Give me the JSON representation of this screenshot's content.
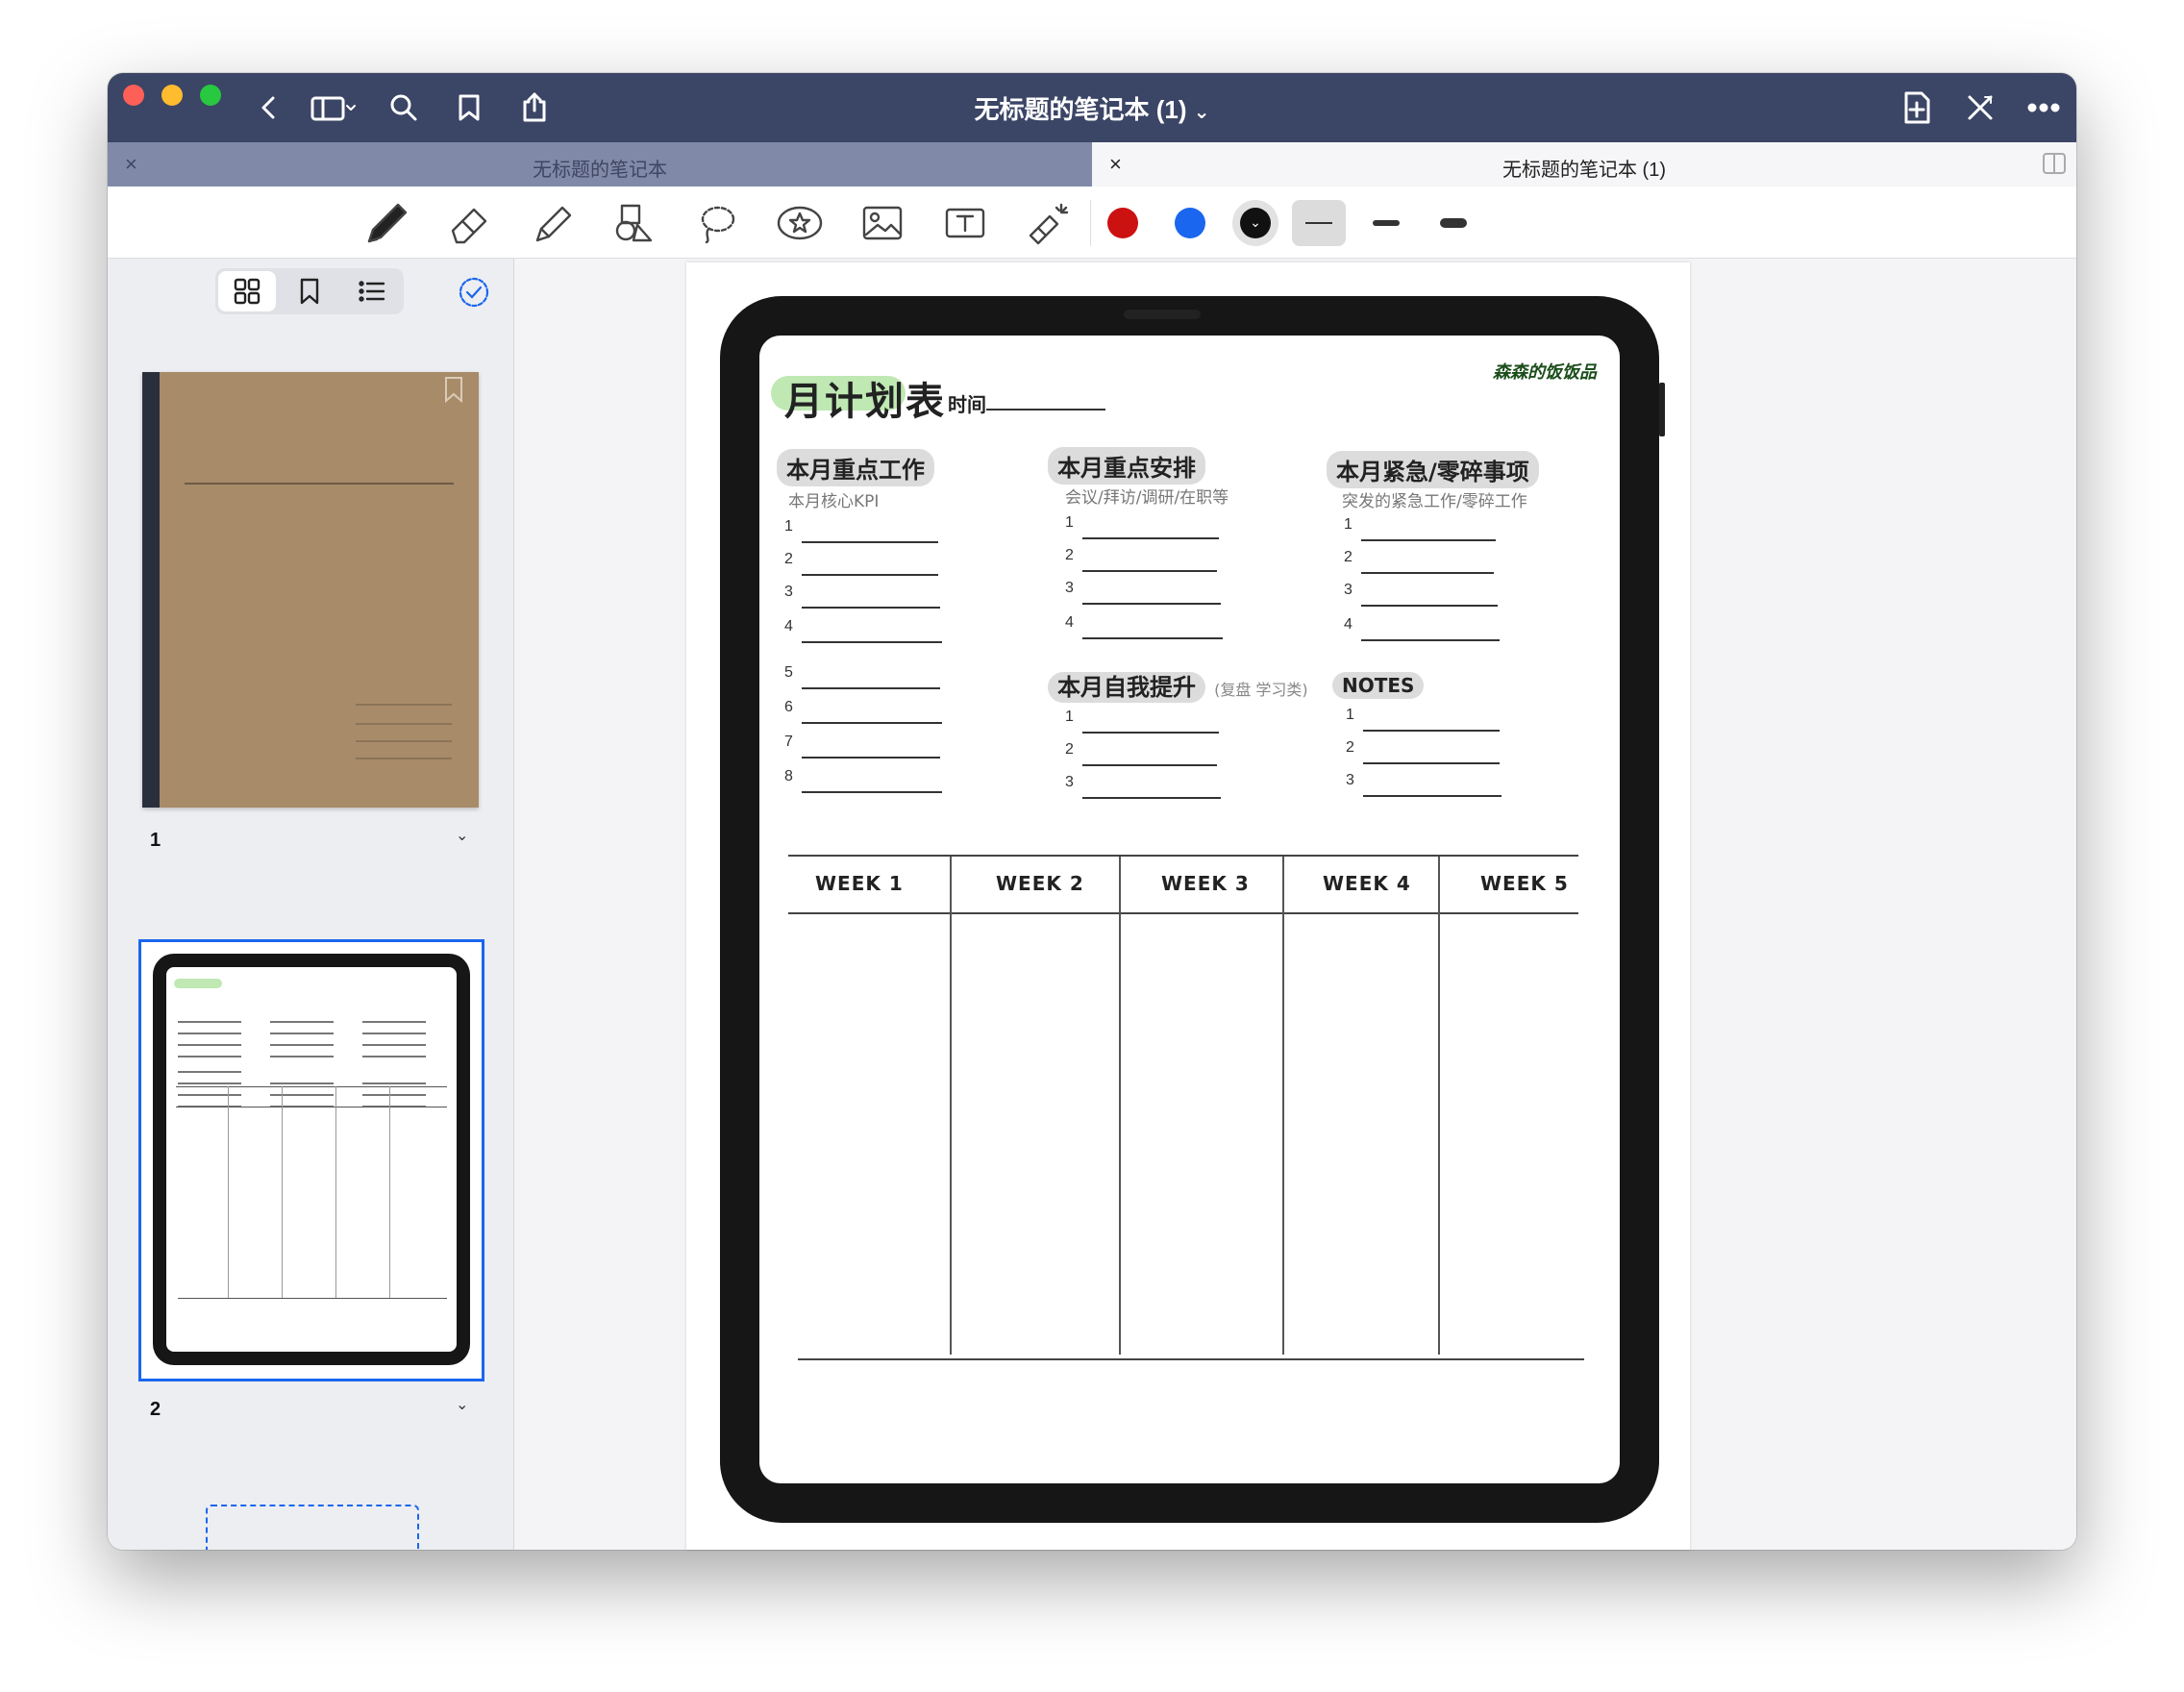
{
  "window": {
    "title": "无标题的笔记本 (1)",
    "title_chevron": "⌄"
  },
  "tabs": [
    {
      "label": "无标题的笔记本",
      "active": false,
      "close": "×"
    },
    {
      "label": "无标题的笔记本 (1)",
      "active": true,
      "close": "×"
    }
  ],
  "toolbar": {
    "tools": [
      "pen-icon",
      "eraser-icon",
      "highlighter-icon",
      "shapes-icon",
      "lasso-icon",
      "sticker-icon",
      "image-icon",
      "text-icon",
      "laser-pointer-icon"
    ],
    "colors": [
      "#cc1111",
      "#1a66ee",
      "#111111"
    ],
    "selected_color": "#111111",
    "stroke_widths": [
      "thin",
      "medium",
      "thick"
    ],
    "selected_width": "thin"
  },
  "sidebar": {
    "modes": [
      "grid-icon",
      "bookmark-icon",
      "outline-icon"
    ],
    "pages": [
      {
        "number": "1",
        "chevron": "⌄"
      },
      {
        "number": "2",
        "chevron": "⌄",
        "selected": true
      }
    ]
  },
  "planner": {
    "title": "月计划表",
    "time_label": "时间",
    "brand": "森森的饭饭品",
    "sections": [
      {
        "heading": "本月重点工作",
        "sub": "本月核心KPI",
        "numbers": [
          "1",
          "2",
          "3",
          "4",
          "5",
          "6",
          "7",
          "8"
        ]
      },
      {
        "heading": "本月重点安排",
        "sub": "会议/拜访/调研/在职等",
        "numbers": [
          "1",
          "2",
          "3",
          "4"
        ]
      },
      {
        "heading": "本月紧急/零碎事项",
        "sub": "突发的紧急工作/零碎工作",
        "numbers": [
          "1",
          "2",
          "3",
          "4"
        ]
      },
      {
        "heading": "本月自我提升",
        "sub": "(复盘 学习类)",
        "numbers": [
          "1",
          "2",
          "3"
        ]
      },
      {
        "heading": "NOTES",
        "sub": "",
        "numbers": [
          "1",
          "2",
          "3"
        ]
      }
    ],
    "weeks": [
      "WEEK 1",
      "WEEK 2",
      "WEEK 3",
      "WEEK 4",
      "WEEK 5"
    ]
  }
}
